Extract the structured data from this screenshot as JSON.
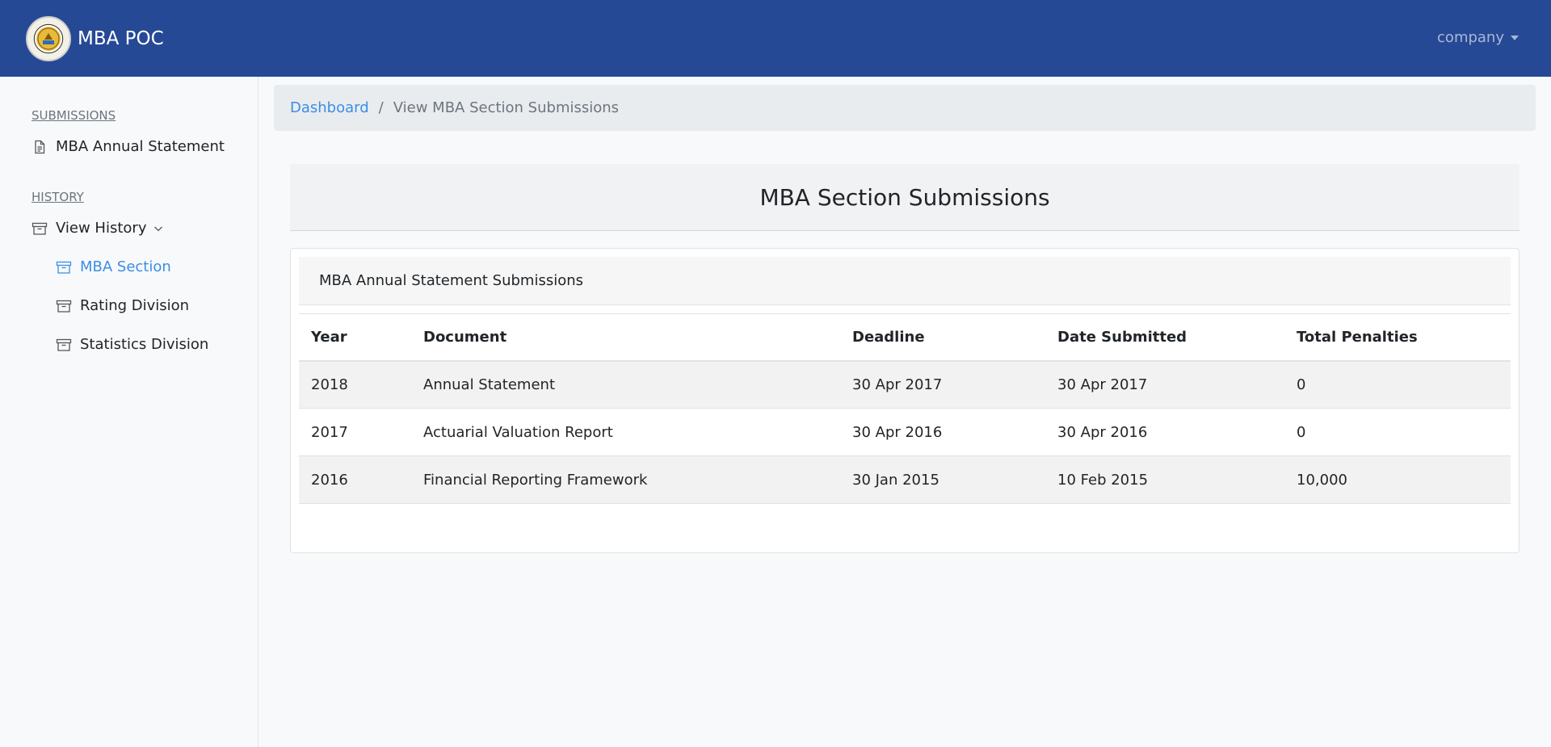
{
  "navbar": {
    "brand": "MBA POC",
    "user_menu": "company"
  },
  "sidebar": {
    "submissions_heading": "SUBMISSIONS",
    "submissions_items": [
      {
        "label": "MBA Annual Statement",
        "icon": "document-icon"
      }
    ],
    "history_heading": "HISTORY",
    "history_toggle": {
      "label": "View History",
      "icon": "archive-icon"
    },
    "history_items": [
      {
        "label": "MBA Section",
        "icon": "archive-icon",
        "active": true
      },
      {
        "label": "Rating Division",
        "icon": "archive-icon",
        "active": false
      },
      {
        "label": "Statistics Division",
        "icon": "archive-icon",
        "active": false
      }
    ]
  },
  "breadcrumb": {
    "home": "Dashboard",
    "current": "View MBA Section Submissions"
  },
  "main": {
    "title": "MBA Section Submissions",
    "card_title": "MBA Annual Statement Submissions",
    "table": {
      "headers": [
        "Year",
        "Document",
        "Deadline",
        "Date Submitted",
        "Total Penalties"
      ],
      "rows": [
        [
          "2018",
          "Annual Statement",
          "30 Apr 2017",
          "30 Apr 2017",
          "0"
        ],
        [
          "2017",
          "Actuarial Valuation Report",
          "30 Apr 2016",
          "30 Apr 2016",
          "0"
        ],
        [
          "2016",
          "Financial Reporting Framework",
          "30 Jan 2015",
          "10 Feb 2015",
          "10,000"
        ]
      ]
    }
  },
  "colors": {
    "navbar": "#264996",
    "accent": "#3a8ee6"
  }
}
